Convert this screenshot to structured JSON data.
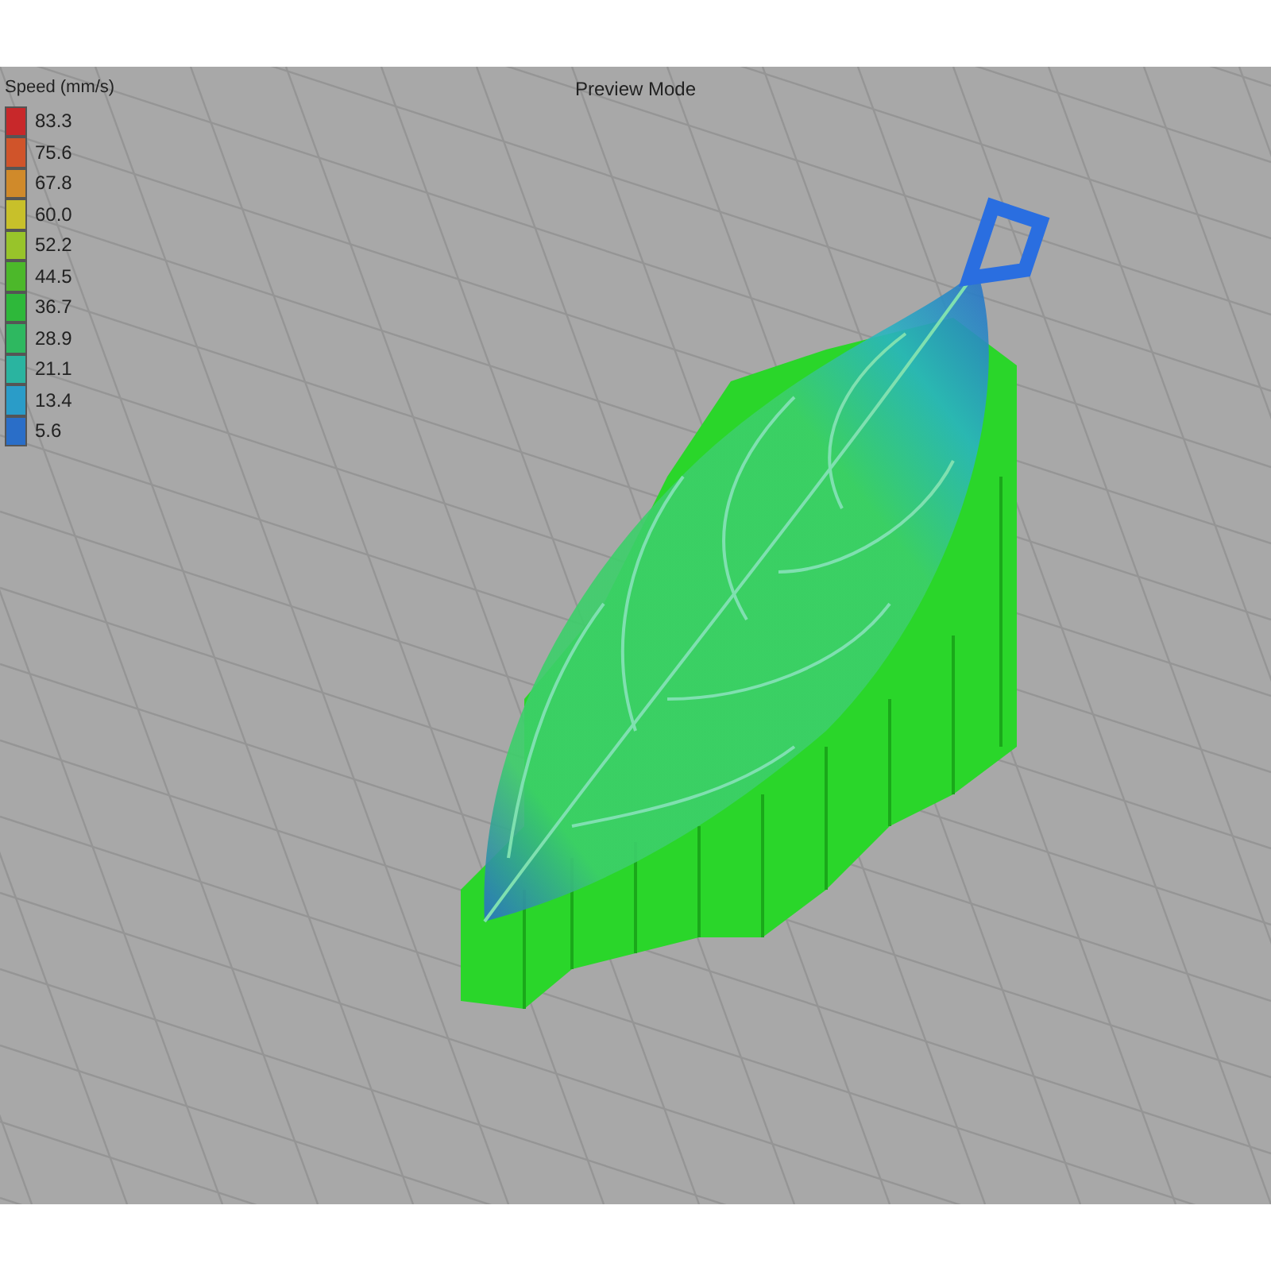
{
  "viewport": {
    "title": "Preview Mode"
  },
  "legend": {
    "title": "Speed (mm/s)",
    "items": [
      {
        "label": "83.3",
        "color": "#c8282a"
      },
      {
        "label": "75.6",
        "color": "#d0542a"
      },
      {
        "label": "67.8",
        "color": "#d08a2a"
      },
      {
        "label": "60.0",
        "color": "#c8c02a"
      },
      {
        "label": "52.2",
        "color": "#98c42a"
      },
      {
        "label": "44.5",
        "color": "#4cb82a"
      },
      {
        "label": "36.7",
        "color": "#2eb83a"
      },
      {
        "label": "28.9",
        "color": "#2eb860"
      },
      {
        "label": "21.1",
        "color": "#2ab4a0"
      },
      {
        "label": "13.4",
        "color": "#2a9cc8"
      },
      {
        "label": "5.6",
        "color": "#2a6ec8"
      }
    ]
  }
}
